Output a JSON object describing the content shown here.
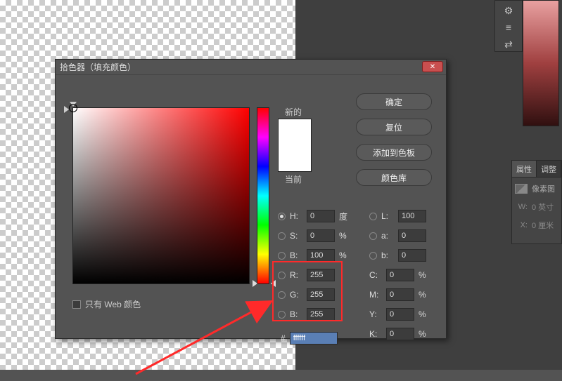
{
  "dialog": {
    "title": "拾色器（填充颜色）",
    "swatch_new_label": "新的",
    "swatch_current_label": "当前",
    "hex_prefix": "#",
    "hex_value": "ffffff",
    "web_only_label": "只有 Web 颜色",
    "buttons": {
      "ok": "确定",
      "reset": "复位",
      "add_swatches": "添加到色板",
      "color_lib": "颜色库"
    },
    "hsb": {
      "h_label": "H:",
      "h_value": "0",
      "h_unit": "度",
      "s_label": "S:",
      "s_value": "0",
      "s_unit": "%",
      "b_label": "B:",
      "b_value": "100",
      "b_unit": "%"
    },
    "rgb": {
      "r_label": "R:",
      "r_value": "255",
      "g_label": "G:",
      "g_value": "255",
      "b_label": "B:",
      "b_value": "255"
    },
    "lab": {
      "l_label": "L:",
      "l_value": "100",
      "a_label": "a:",
      "a_value": "0",
      "b_label": "b:",
      "b_value": "0"
    },
    "cmyk": {
      "c_label": "C:",
      "c_value": "0",
      "c_unit": "%",
      "m_label": "M:",
      "m_value": "0",
      "m_unit": "%",
      "y_label": "Y:",
      "y_value": "0",
      "y_unit": "%",
      "k_label": "K:",
      "k_value": "0",
      "k_unit": "%"
    }
  },
  "right_panel": {
    "tab_properties": "属性",
    "tab_adjustments": "调整",
    "pixmap_label": "像素图",
    "w_label": "W:",
    "w_value": "0 英寸",
    "x_label": "X:",
    "x_value": "0 厘米"
  }
}
